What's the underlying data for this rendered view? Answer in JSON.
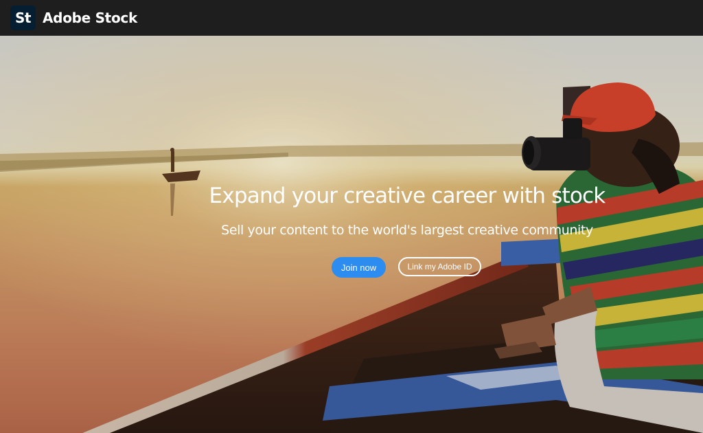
{
  "header": {
    "logo_text": "St",
    "brand_name": "Adobe Stock"
  },
  "hero": {
    "headline": "Expand your creative career with stock",
    "subheadline": "Sell your content to the world's largest creative community",
    "primary_button": "Join now",
    "secondary_button": "Link my Adobe ID"
  },
  "colors": {
    "topbar": "#1e1e1e",
    "logo_badge": "#061e32",
    "primary_button": "#2d8cf0"
  }
}
